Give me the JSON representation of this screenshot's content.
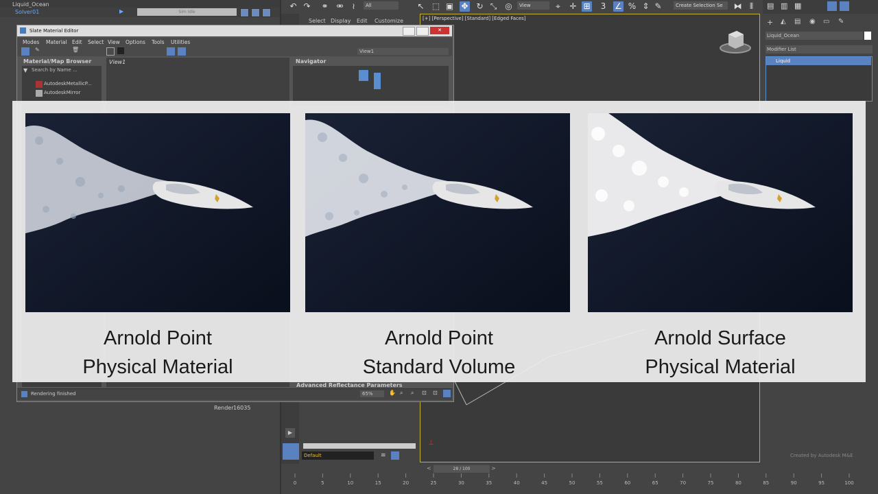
{
  "explorer": {
    "rows": [
      "Liquid_Ocean",
      "Solver01"
    ],
    "sim_label": "Sim Idle",
    "render_label": "Render",
    "render_value": "16035"
  },
  "toolbar": {
    "filter_value": "All",
    "view_value": "View",
    "selection_set": "Create Selection Se"
  },
  "viewport": {
    "label": "[+] [Perspective] [Standard] [Edged Faces]",
    "menu": [
      "Select",
      "Display",
      "Edit",
      "Customize"
    ]
  },
  "command_panel": {
    "object_name": "Liquid_Ocean",
    "modifier_list": "Modifier List",
    "stack_item": "Liquid"
  },
  "slate": {
    "title": "Slate Material Editor",
    "menu": [
      "Modes",
      "Material",
      "Edit",
      "Select",
      "View",
      "Options",
      "Tools",
      "Utilities"
    ],
    "view_dropdown": "View1",
    "browser_title": "Material/Map Browser",
    "search_placeholder": "Search by Name ...",
    "browser_items": [
      "AutodeskMetallicP...",
      "AutodeskMirror"
    ],
    "view_tab": "View1",
    "navigator_title": "Navigator",
    "reflectance_header": "Advanced Reflectance Parameters",
    "status": "Rendering finished",
    "zoom": "65%"
  },
  "bottom": {
    "layer": "Default",
    "time_slider": "28 / 100",
    "ticks": [
      "0",
      "5",
      "10",
      "15",
      "20",
      "25",
      "30",
      "35",
      "40",
      "45",
      "50",
      "55",
      "60",
      "65",
      "70",
      "75",
      "80",
      "85",
      "90",
      "95",
      "100"
    ],
    "credit": "Created by Autodesk M&E"
  },
  "comparison": [
    {
      "line1": "Arnold Point",
      "line2": "Physical Material",
      "style": "spray"
    },
    {
      "line1": "Arnold Point",
      "line2": "Standard Volume",
      "style": "spray"
    },
    {
      "line1": "Arnold Surface",
      "line2": "Physical Material",
      "style": "foam"
    }
  ],
  "colors": {
    "accent": "#5a82c0",
    "viewport_border": "#c8b030",
    "ocean": "#0f1524",
    "overlay": "#eeeeee"
  }
}
